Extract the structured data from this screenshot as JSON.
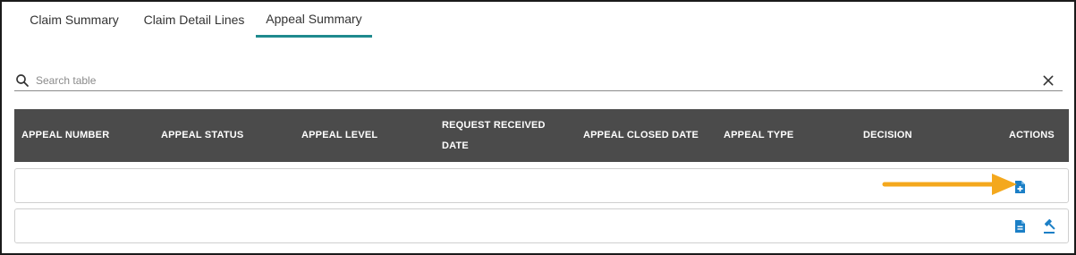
{
  "tabs": [
    {
      "label": "Claim Summary",
      "active": false
    },
    {
      "label": "Claim Detail Lines",
      "active": false
    },
    {
      "label": "Appeal Summary",
      "active": true
    }
  ],
  "search": {
    "placeholder": "Search table",
    "value": ""
  },
  "table": {
    "columns": [
      "APPEAL NUMBER",
      "APPEAL STATUS",
      "APPEAL LEVEL",
      "REQUEST RECEIVED DATE",
      "APPEAL CLOSED DATE",
      "APPEAL TYPE",
      "DECISION",
      "ACTIONS"
    ],
    "rows": [
      {
        "actions": [
          "document-plus-icon"
        ]
      },
      {
        "actions": [
          "document-icon",
          "gavel-icon"
        ]
      }
    ]
  },
  "colors": {
    "accent": "#1f8a8e",
    "header_bg": "#4b4b4b",
    "icon_blue": "#1b7fc6",
    "arrow": "#f4a81d"
  }
}
